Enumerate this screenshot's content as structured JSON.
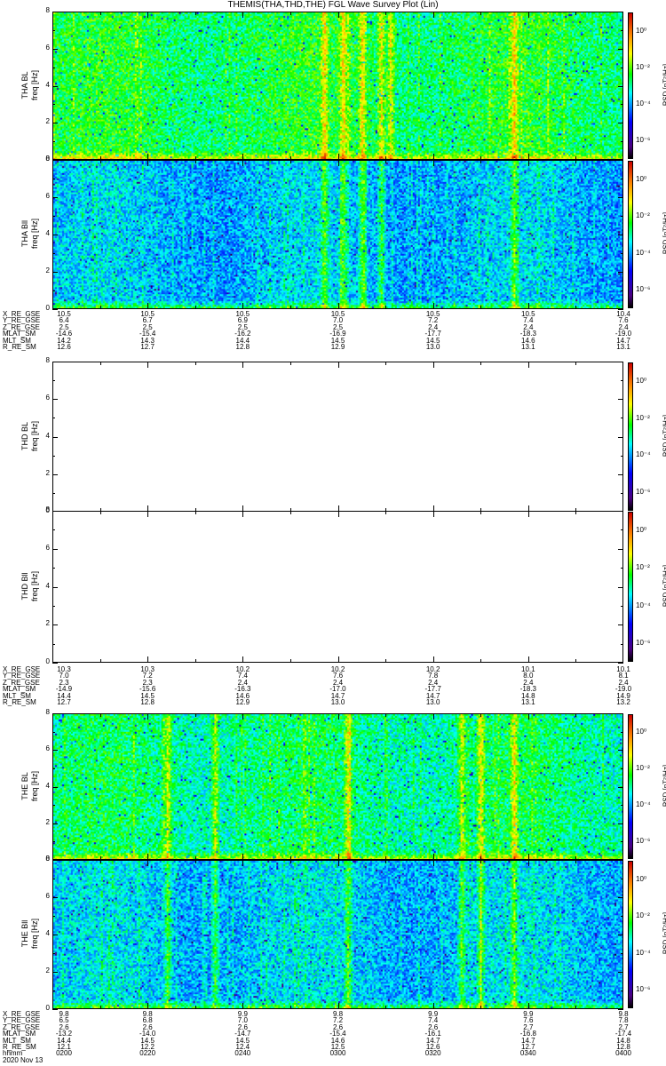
{
  "chart_data": {
    "type": "heatmap",
    "title": "THEMIS(THA,THD,THE) FGL Wave Survey Plot (Lin)",
    "date": "2020 Nov 13",
    "time_ticks": [
      "0200",
      "0220",
      "0240",
      "0300",
      "0320",
      "0340",
      "0400"
    ],
    "time_label": "hhmm",
    "y_range": [
      0,
      8
    ],
    "y_ticks": [
      "0",
      "2",
      "4",
      "6",
      "8"
    ],
    "colorbar": {
      "label": "PSD [nT²/Hz]",
      "log_range": [
        -7,
        1
      ],
      "tick_labels": [
        "10⁰",
        "10⁻²",
        "10⁻⁴",
        "10⁻⁶"
      ],
      "tick_values": [
        0,
        -2,
        -4,
        -6
      ]
    },
    "panels": [
      {
        "probe": "THA",
        "label": "THA BL",
        "ylabel": "freq [Hz]",
        "base_log_psd": -2.6,
        "enhanced_times_min": [
          57,
          61,
          65,
          69,
          71,
          97
        ],
        "empty": false
      },
      {
        "probe": "THA",
        "label": "THA Bll",
        "ylabel": "freq [Hz]",
        "base_log_psd": -3.8,
        "enhanced_times_min": [
          57,
          61,
          65,
          69,
          97
        ],
        "empty": false
      },
      {
        "probe": "THD",
        "label": "THD BL",
        "ylabel": "freq [Hz]",
        "base_log_psd": null,
        "enhanced_times_min": [],
        "empty": true
      },
      {
        "probe": "THD",
        "label": "THD Bll",
        "ylabel": "freq [Hz]",
        "base_log_psd": null,
        "enhanced_times_min": [],
        "empty": true
      },
      {
        "probe": "THE",
        "label": "THE BL",
        "ylabel": "freq [Hz]",
        "base_log_psd": -2.9,
        "enhanced_times_min": [
          24,
          34,
          62,
          86,
          90,
          97
        ],
        "empty": false
      },
      {
        "probe": "THE",
        "label": "THE Bll",
        "ylabel": "freq [Hz]",
        "base_log_psd": -3.7,
        "enhanced_times_min": [
          24,
          34,
          62,
          86,
          90,
          97
        ],
        "empty": false
      }
    ],
    "ephemeris": [
      {
        "probe": "THA",
        "rows": [
          {
            "name": "X_RE_GSE",
            "values": [
              "10.5",
              "10.5",
              "10.5",
              "10.5",
              "10.5",
              "10.5",
              "10.4"
            ]
          },
          {
            "name": "Y_RE_GSE",
            "values": [
              "6.4",
              "6.7",
              "6.9",
              "7.0",
              "7.2",
              "7.4",
              "7.6"
            ]
          },
          {
            "name": "Z_RE_GSE",
            "values": [
              "2.5",
              "2.5",
              "2.5",
              "2.5",
              "2.4",
              "2.4",
              "2.4"
            ]
          },
          {
            "name": "MLAT_SM",
            "values": [
              "-14.6",
              "-15.4",
              "-16.2",
              "-16.9",
              "-17.7",
              "-18.3",
              "-19.0"
            ]
          },
          {
            "name": "MLT_SM",
            "values": [
              "14.2",
              "14.3",
              "14.4",
              "14.5",
              "14.5",
              "14.6",
              "14.7"
            ]
          },
          {
            "name": "R_RE_SM",
            "values": [
              "12.6",
              "12.7",
              "12.8",
              "12.9",
              "13.0",
              "13.1",
              "13.1"
            ]
          }
        ]
      },
      {
        "probe": "THD",
        "rows": [
          {
            "name": "X_RE_GSE",
            "values": [
              "10.3",
              "10.3",
              "10.2",
              "10.2",
              "10.2",
              "10.1",
              "10.1"
            ]
          },
          {
            "name": "Y_RE_GSE",
            "values": [
              "7.0",
              "7.2",
              "7.4",
              "7.6",
              "7.8",
              "8.0",
              "8.1"
            ]
          },
          {
            "name": "Z_RE_GSE",
            "values": [
              "2.3",
              "2.3",
              "2.4",
              "2.4",
              "2.4",
              "2.4",
              "2.4"
            ]
          },
          {
            "name": "MLAT_SM",
            "values": [
              "-14.9",
              "-15.6",
              "-16.3",
              "-17.0",
              "-17.7",
              "-18.3",
              "-19.0"
            ]
          },
          {
            "name": "MLT_SM",
            "values": [
              "14.4",
              "14.5",
              "14.6",
              "14.7",
              "14.7",
              "14.8",
              "14.9"
            ]
          },
          {
            "name": "R_RE_SM",
            "values": [
              "12.7",
              "12.8",
              "12.9",
              "13.0",
              "13.0",
              "13.1",
              "13.2"
            ]
          }
        ]
      },
      {
        "probe": "THE",
        "rows": [
          {
            "name": "X_RE_GSE",
            "values": [
              "9.8",
              "9.8",
              "9.9",
              "9.8",
              "9.9",
              "9.9",
              "9.8"
            ]
          },
          {
            "name": "Y_RE_GSE",
            "values": [
              "6.5",
              "6.8",
              "7.0",
              "7.2",
              "7.4",
              "7.6",
              "7.8"
            ]
          },
          {
            "name": "Z_RE_GSE",
            "values": [
              "2.6",
              "2.6",
              "2.6",
              "2.6",
              "2.6",
              "2.7",
              "2.7"
            ]
          },
          {
            "name": "MLAT_SM",
            "values": [
              "-13.2",
              "-14.0",
              "-14.7",
              "-15.4",
              "-16.1",
              "-16.8",
              "-17.4"
            ]
          },
          {
            "name": "MLT_SM",
            "values": [
              "14.4",
              "14.5",
              "14.5",
              "14.6",
              "14.7",
              "14.7",
              "14.8"
            ]
          },
          {
            "name": "R_RE_SM",
            "values": [
              "12.1",
              "12.2",
              "12.4",
              "12.5",
              "12.6",
              "12.7",
              "12.8"
            ]
          }
        ]
      }
    ]
  }
}
